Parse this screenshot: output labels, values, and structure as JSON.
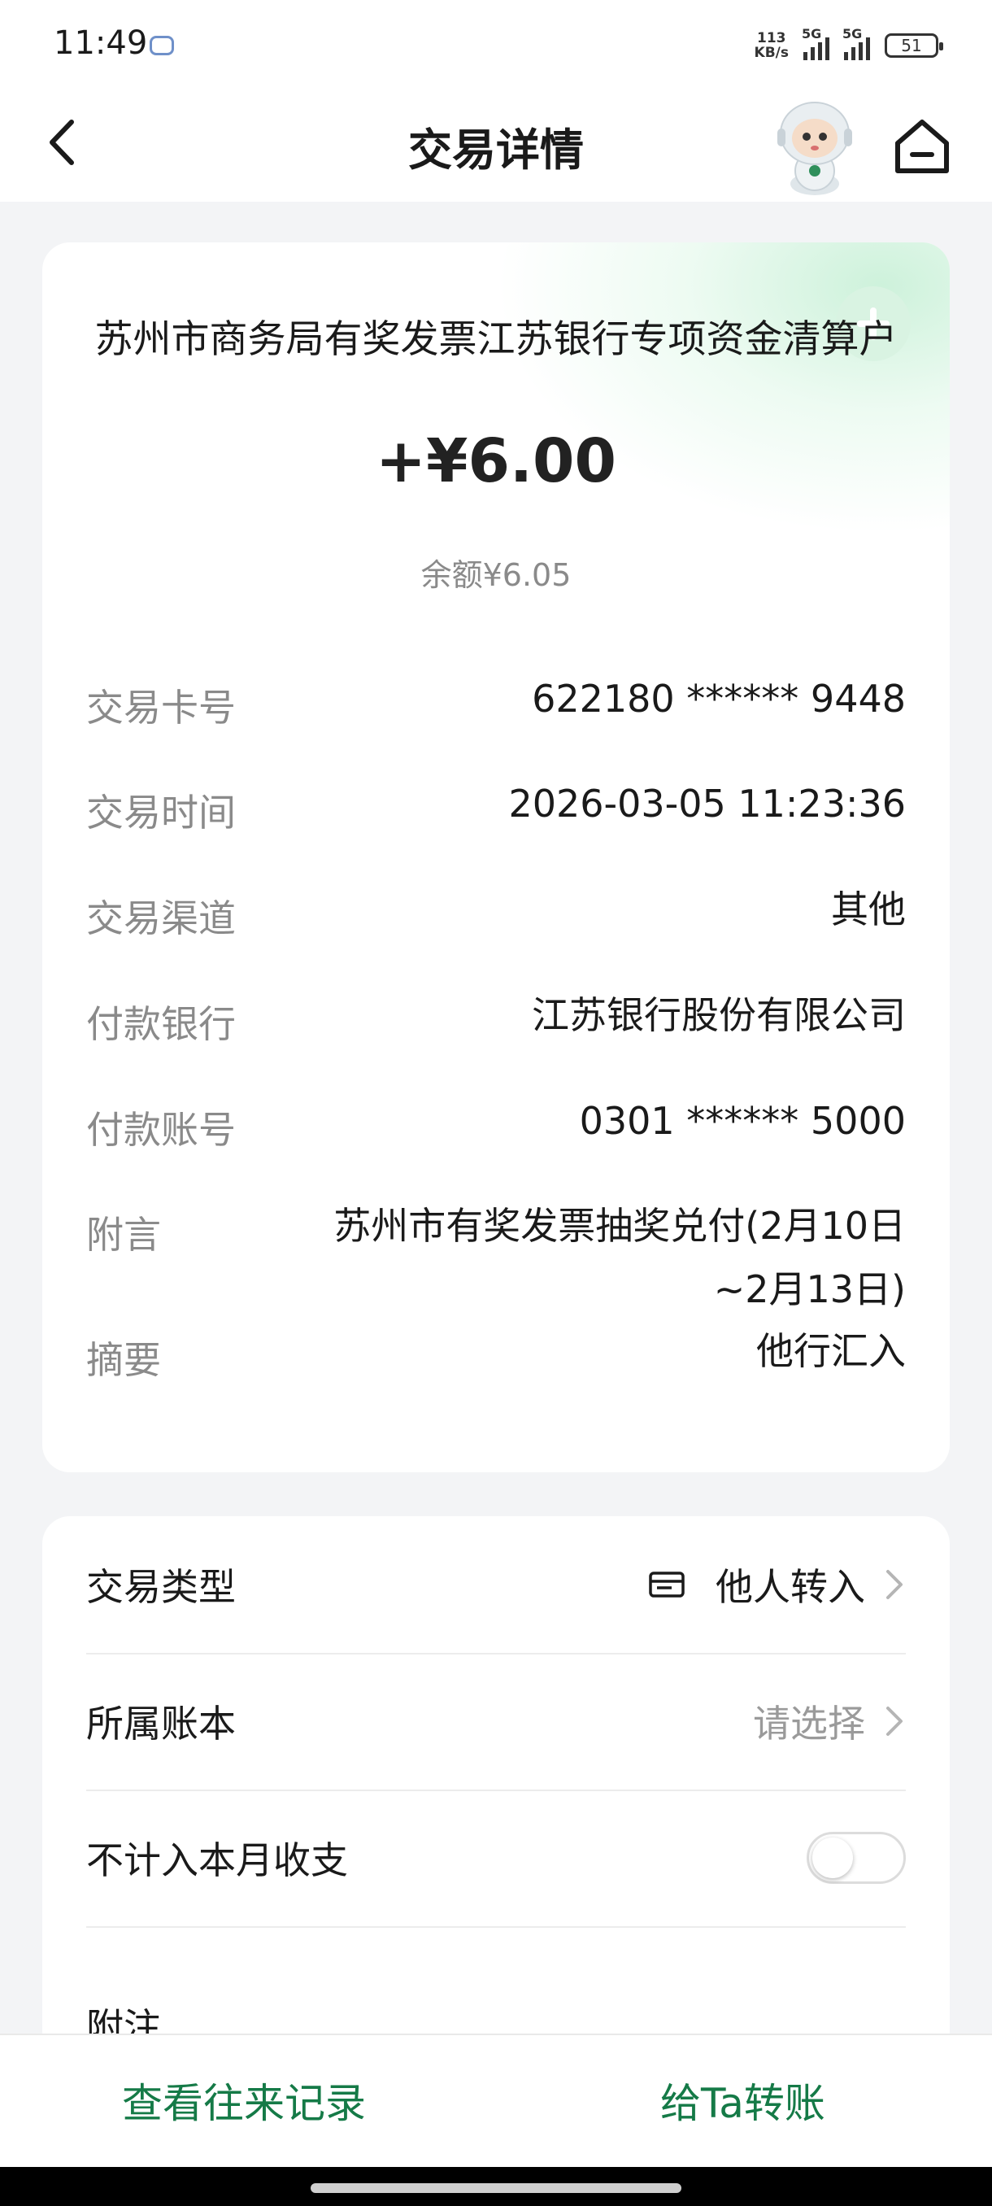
{
  "status_bar": {
    "time": "11:49",
    "net_speed_value": "113",
    "net_speed_unit": "KB/s",
    "signal1_label": "5G",
    "signal2_label": "5G",
    "battery": "51"
  },
  "header": {
    "title": "交易详情",
    "back_icon": "chevron-left-icon",
    "home_icon": "home-icon",
    "mascot_icon": "astronaut-mascot-icon"
  },
  "transaction": {
    "counterparty": "苏州市商务局有奖发票江苏银行专项资金清算户",
    "amount": "+¥6.00",
    "balance": "余额¥6.05",
    "details": [
      {
        "label": "交易卡号",
        "value": "622180 ****** 9448"
      },
      {
        "label": "交易时间",
        "value": "2026-03-05 11:23:36"
      },
      {
        "label": "交易渠道",
        "value": "其他"
      },
      {
        "label": "付款银行",
        "value": "江苏银行股份有限公司"
      },
      {
        "label": "付款账号",
        "value": "0301 ****** 5000"
      },
      {
        "label": "附言",
        "value": "苏州市有奖发票抽奖兑付(2月10日~2月13日)"
      },
      {
        "label": "摘要",
        "value": "他行汇入"
      }
    ]
  },
  "settings": {
    "type_label": "交易类型",
    "type_value": "他人转入",
    "ledger_label": "所属账本",
    "ledger_value": "请选择",
    "exclude_label": "不计入本月收支",
    "exclude_enabled": false,
    "note_label": "附注"
  },
  "bottom": {
    "history_label": "查看往来记录",
    "transfer_label": "给Ta转账"
  },
  "colors": {
    "accent_green": "#157a47",
    "background": "#f3f4f6",
    "label_gray": "#8a8a8a"
  }
}
